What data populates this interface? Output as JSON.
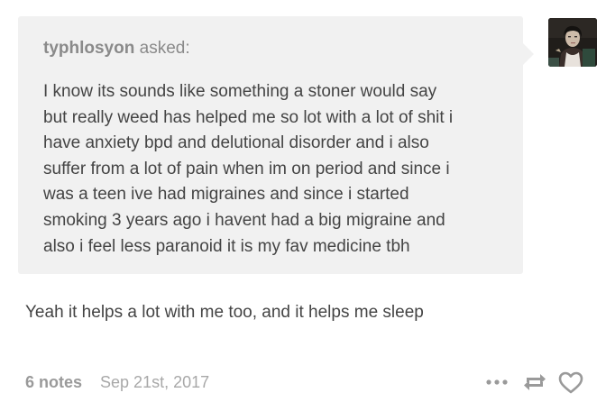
{
  "ask": {
    "asker_name": "typhlosyon",
    "asked_label": "asked:",
    "question_lines": [
      "I know its sounds like something a stoner would say",
      "but really weed has helped me so lot with a lot of shit i",
      "have anxiety bpd and delutional disorder and i also",
      "suffer from a lot of pain when im on period and since i",
      "was a teen ive had migraines and since i started",
      "smoking 3 years ago i havent had a big migraine and",
      "also i feel less paranoid it is my fav medicine tbh"
    ]
  },
  "answer": {
    "text": "Yeah it helps a lot with me too, and it helps me sleep"
  },
  "footer": {
    "notes": "6 notes",
    "date": "Sep 21st, 2017"
  },
  "icons": {
    "more": "more-dots-icon",
    "reblog": "reblog-icon",
    "like": "heart-icon",
    "icon_color": "#9a9a9a"
  },
  "colors": {
    "ask_background": "#f1f1f1",
    "text": "#444444",
    "muted": "#8a8a8a"
  }
}
